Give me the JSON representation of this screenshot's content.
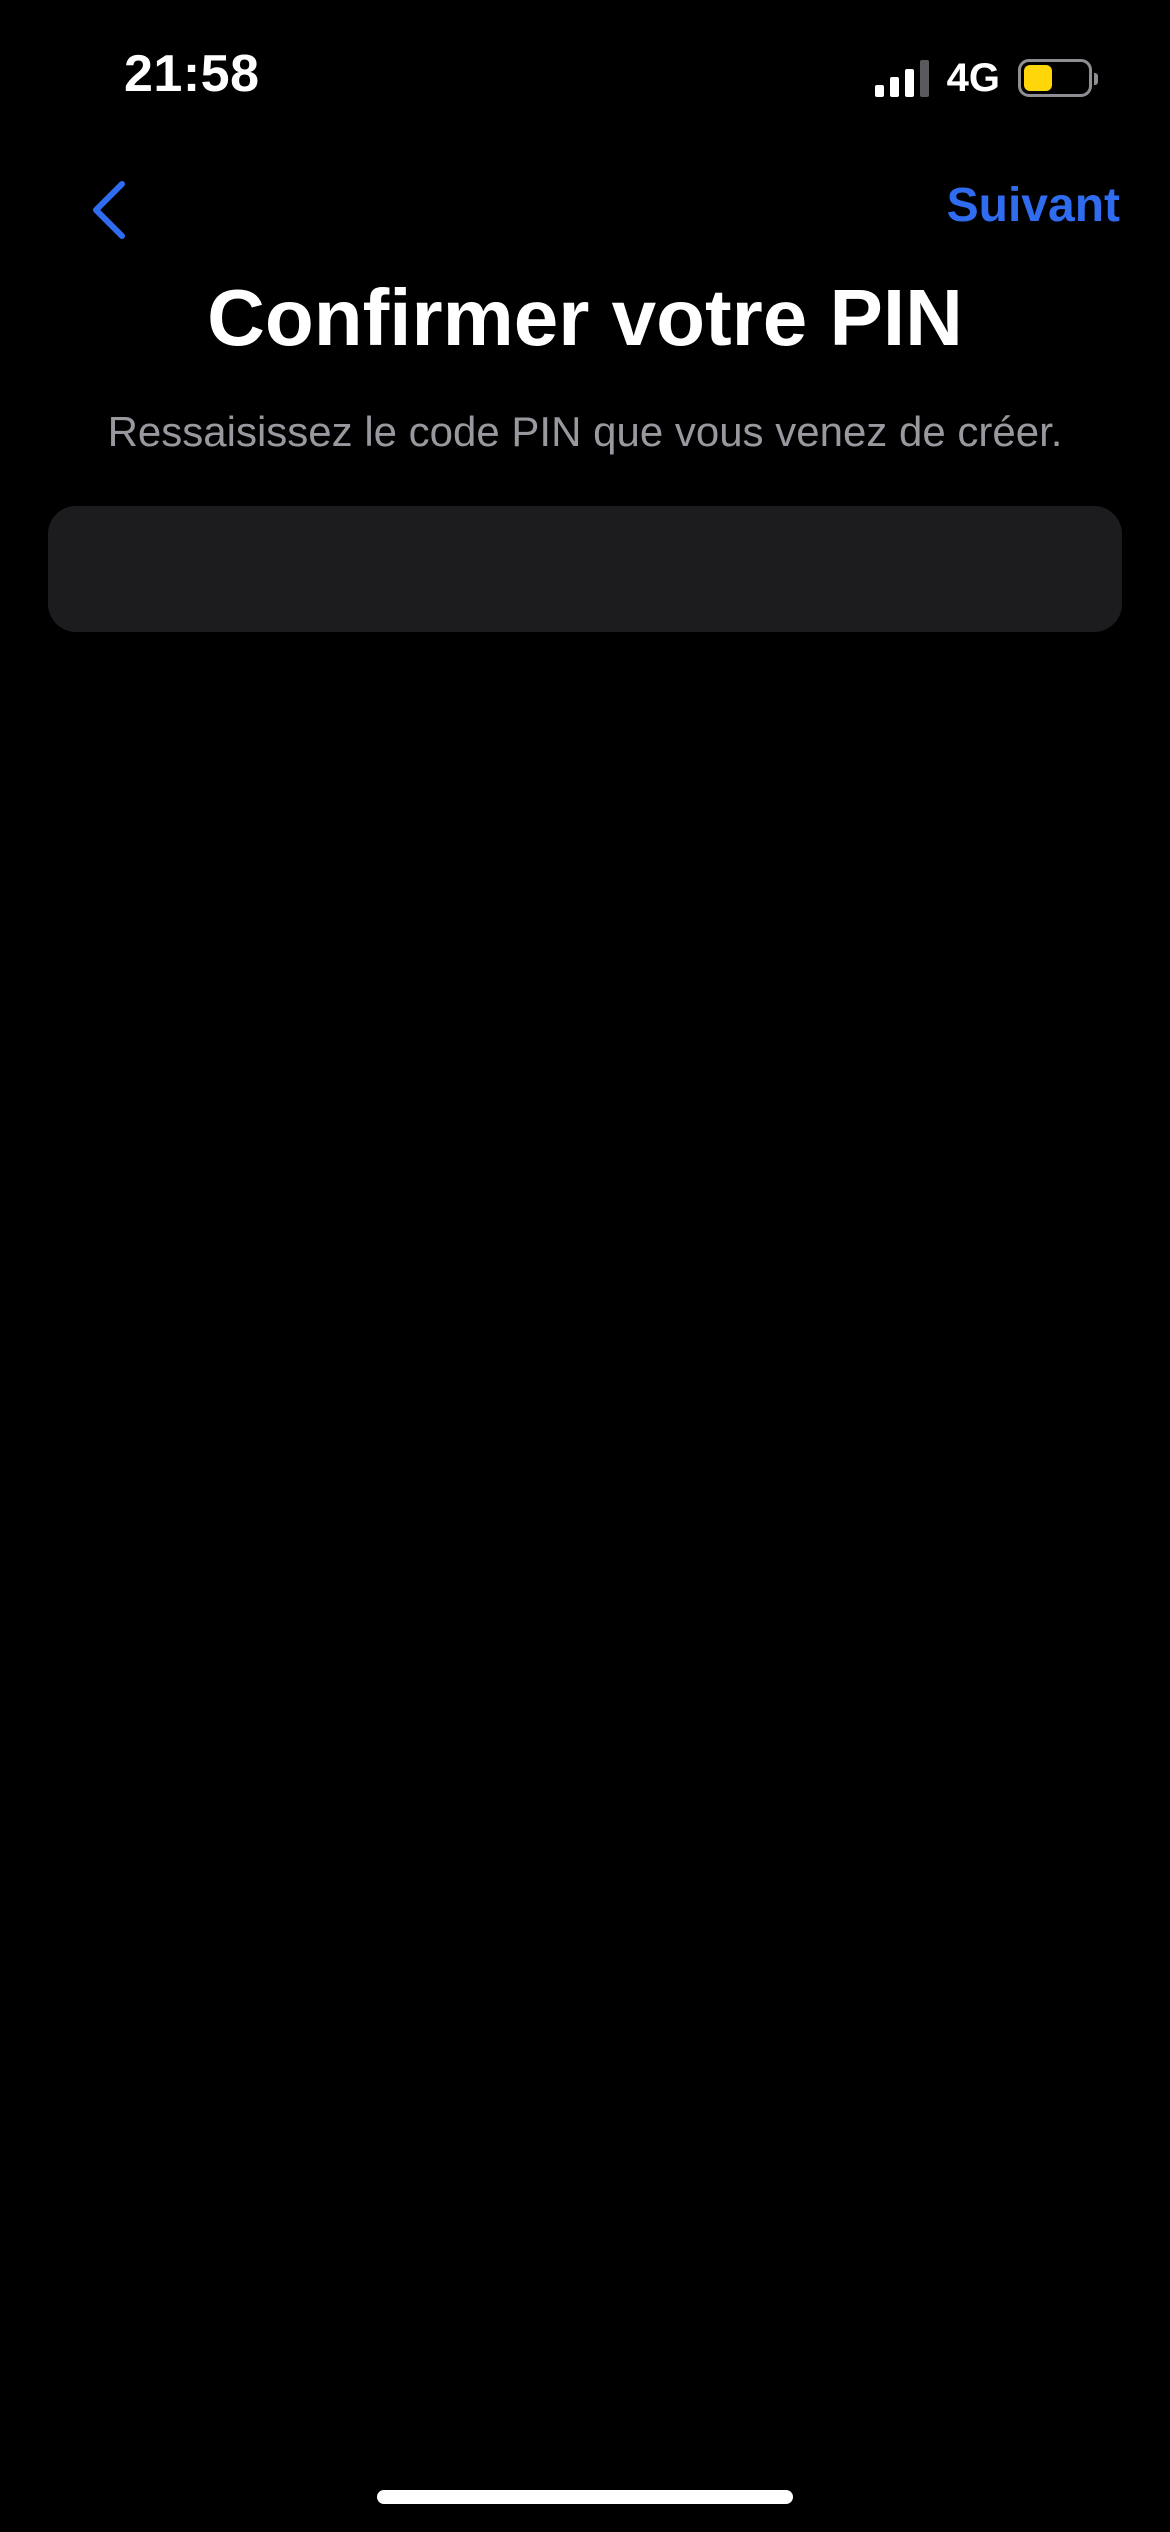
{
  "status_bar": {
    "time": "21:58",
    "network": "4G",
    "battery_level": 0.45,
    "battery_color": "#ffd60a"
  },
  "nav": {
    "back_icon": "chevron-left-icon",
    "next_label": "Suivant",
    "accent_color": "#2f6cf0"
  },
  "content": {
    "title": "Confirmer votre PIN",
    "subtitle": "Ressaisissez le code PIN que vous venez de créer.",
    "pin_value": "",
    "pin_placeholder": ""
  }
}
